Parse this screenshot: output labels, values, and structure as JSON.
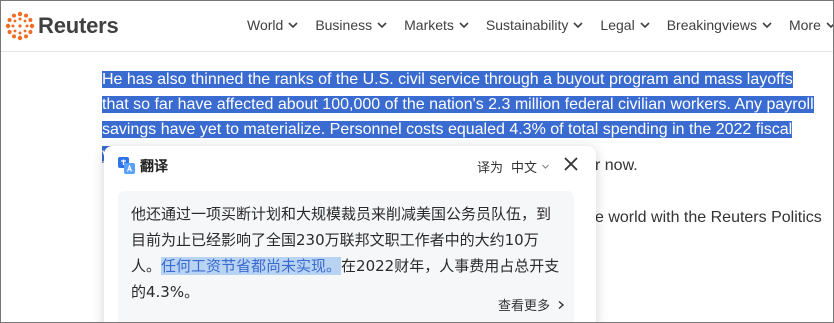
{
  "header": {
    "logo_text": "Reuters",
    "nav": [
      {
        "label": "World"
      },
      {
        "label": "Business"
      },
      {
        "label": "Markets"
      },
      {
        "label": "Sustainability"
      },
      {
        "label": "Legal"
      },
      {
        "label": "Breakingviews"
      },
      {
        "label": "More"
      }
    ]
  },
  "article": {
    "selected_text": "He has also thinned the ranks of the U.S. civil service through a buyout program and mass layoffs that so far have affected about 100,000 of the nation's 2.3 million federal civilian workers. Any payroll savings have yet to materialize. Personnel costs equaled 4.3% of total spending in the 2022 fiscal year.",
    "para2_fragment": "r now.",
    "para3_fragment": "e world with the Reuters Politics"
  },
  "translate_popup": {
    "title": "翻译",
    "translate_to_label": "译为",
    "target_language": "中文",
    "translation_plain": "他还通过一项买断计划和大规模裁员来削减美国公务员队伍，到目前为止已经影响了全国230万联邦文职工作者中的大约10万人。",
    "translation_highlight": "任何工资节省都尚未实现。",
    "translation_rest": "在2022财年，人事费用占总开支的4.3%。",
    "more_link": "查看更多"
  },
  "colors": {
    "selection": "#3a6bd0",
    "logo_accent": "#f26b21"
  }
}
